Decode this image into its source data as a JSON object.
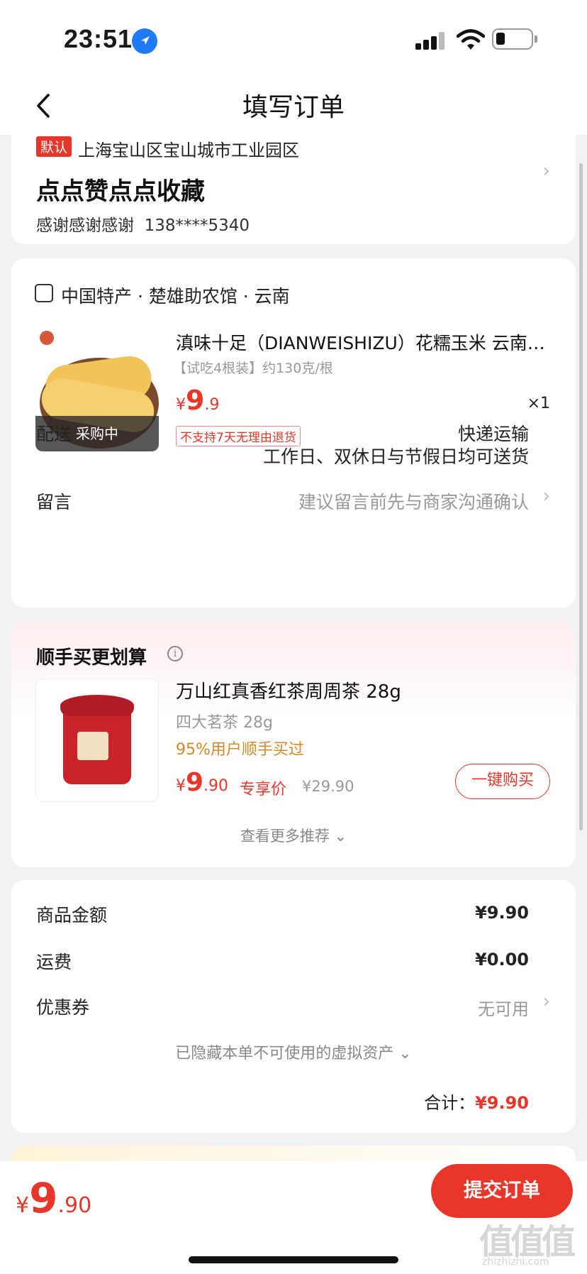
{
  "status_bar": {
    "time": "23:51"
  },
  "nav": {
    "title": "填写订单"
  },
  "address": {
    "badge": "默认",
    "line": "上海宝山区宝山城市工业园区",
    "name": "点点赞点点收藏",
    "contact_name": "感谢感谢感谢",
    "phone": "138****5340"
  },
  "shop": {
    "name": "中国特产 · 楚雄助农馆 · 云南",
    "product": {
      "title": "滇味十足（DIANWEISHIZU）花糯玉米 云南西…",
      "spec": "【试吃4根装】约130克/根",
      "price_currency": "¥",
      "price_int": "9",
      "price_dec": ".9",
      "qty": "×1",
      "buying_tag": "采购中",
      "no_return_tag": "不支持7天无理由退货"
    },
    "shipping_label": "配送",
    "shipping_value": "快递运输",
    "shipping_sub": "工作日、双休日与节假日均可送货",
    "note_label": "留言",
    "note_placeholder": "建议留言前先与商家沟通确认"
  },
  "recommend": {
    "title": "顺手买更划算",
    "item": {
      "title": "万山红真香红茶周周茶 28g",
      "sub": "四大茗茶 28g",
      "percent": "95%用户顺手买过",
      "price_currency": "¥",
      "price_int": "9",
      "price_dec": ".90",
      "exclusive": "专享价",
      "original": "¥29.90",
      "buy_button": "一键购买"
    },
    "more": "查看更多推荐 ⌄"
  },
  "summary": {
    "goods_label": "商品金额",
    "goods_value": "¥9.90",
    "freight_label": "运费",
    "freight_value": "¥0.00",
    "coupon_label": "优惠券",
    "coupon_value": "无可用",
    "hidden_assets": "已隐藏本单不可使用的虚拟资产 ⌄",
    "total_label": "合计：",
    "total_value": "¥9.90"
  },
  "bottom_bar": {
    "price_currency": "¥",
    "price_int": "9",
    "price_dec": ".90",
    "submit": "提交订单"
  },
  "watermark": {
    "main": "值值值",
    "sub": "zhizhizhi.com"
  }
}
